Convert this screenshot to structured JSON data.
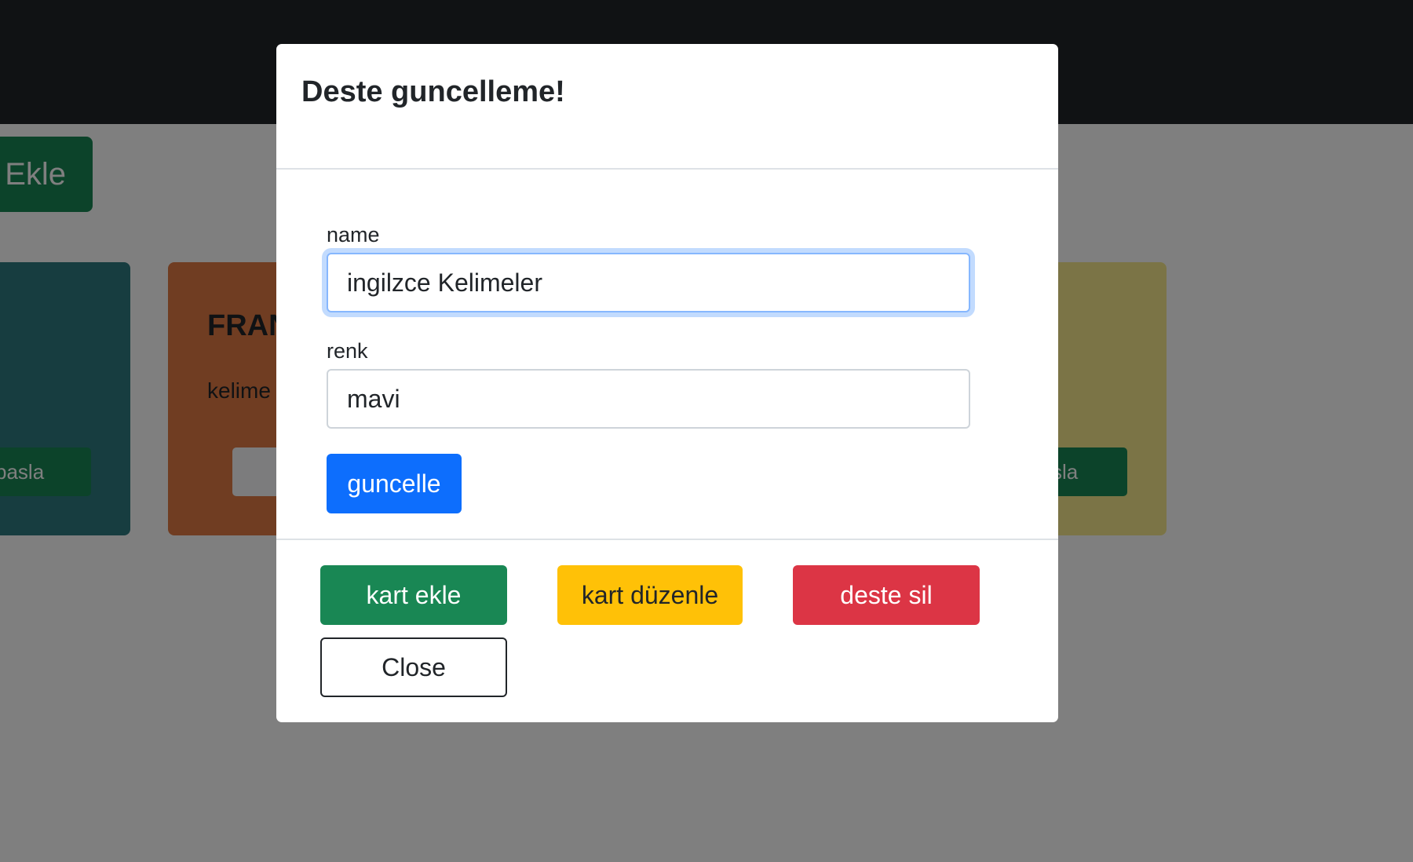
{
  "background": {
    "add_deck_label": "Ekle",
    "cards": [
      {
        "color": "#2f7a80",
        "title": "",
        "subtitle": "",
        "button_label": "pasla"
      },
      {
        "color": "#e07a45",
        "title": "FRAN",
        "subtitle": "kelime",
        "button_label": ""
      },
      {
        "color": "#f7e98c",
        "title": "",
        "subtitle": "",
        "button_label": "sla"
      }
    ]
  },
  "modal": {
    "title": "Deste guncelleme!",
    "fields": {
      "name": {
        "label": "name",
        "value": "ingilzce Kelimeler"
      },
      "renk": {
        "label": "renk",
        "value": "mavi"
      }
    },
    "update_button": "guncelle",
    "footer": {
      "kart_ekle": "kart ekle",
      "kart_duzenle": "kart düzenle",
      "deste_sil": "deste sil",
      "close": "Close"
    }
  },
  "colors": {
    "primary": "#0d6efd",
    "success": "#198754",
    "warning": "#ffc107",
    "danger": "#dc3545",
    "navbar": "#212529"
  }
}
